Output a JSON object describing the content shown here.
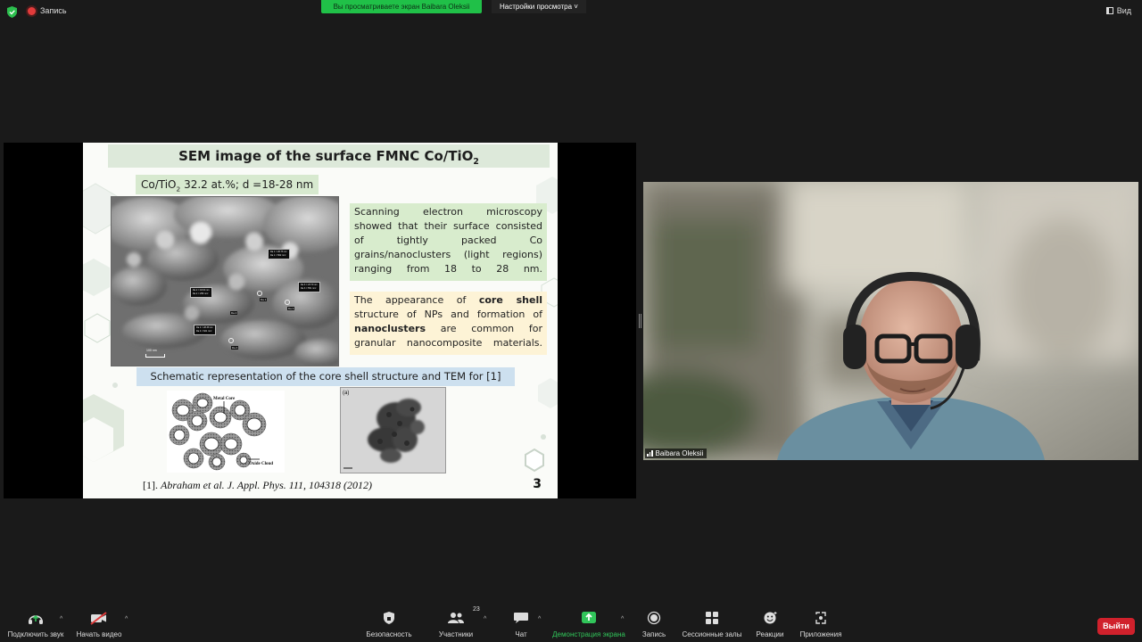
{
  "topbar": {
    "record_label": "Запись",
    "sharing_banner": "Вы просматриваете экран Baibara Oleksii",
    "view_settings": "Настройки просмотра",
    "view_label": "Вид"
  },
  "slide": {
    "title": "SEM image of the surface FMNC Co/TiO",
    "title_sub": "2",
    "subtitle_a": "Co/TiO",
    "subtitle_sub": "2",
    "subtitle_b": " 32.2 at.%; d =18-28 nm",
    "green_text": "Scanning electron microscopy showed that their surface consisted of tightly packed Co grains/nanoclusters (light regions) ranging from 18 to 28 nm.",
    "yellow_a": "The appearance of ",
    "yellow_b": "core shell",
    "yellow_c": " structure of NPs and formation of ",
    "yellow_d": "nanoclusters",
    "yellow_e": " are common for granular nanocomposite materials.",
    "schem_label": "Schematic representation of the core shell structure and TEM for [1]",
    "citation_ref": "[1]. ",
    "citation_text": "Abraham et al. J. Appl. Phys. 111, 104318 (2012)",
    "page_number": "3",
    "diagram_core": "Metal Core",
    "diagram_cloud": "Oxide Cloud",
    "tem_panel": "(a)",
    "sem_scale": "100 nm",
    "sem_tags": [
      {
        "l1": "Da 1 = 26.76 nm",
        "l2": "Da 1 = 562 nm²"
      },
      {
        "l1": "Da 2 = 18.04 nm",
        "l2": "Da 2 = 256 nm²"
      },
      {
        "l1": "Da 3 = 23.70 nm",
        "l2": "Da 3 = 551 nm²"
      },
      {
        "l1": "Da 4 = 28.38 nm",
        "l2": "Da 4 = 621 nm²"
      }
    ],
    "sem_nums": [
      "Da 1",
      "Da 2",
      "Da 3",
      "Da 4"
    ]
  },
  "video": {
    "participant_name": "Baibara Oleksii"
  },
  "toolbar": {
    "audio": "Подключить звук",
    "video": "Начать видео",
    "security": "Безопасность",
    "participants": "Участники",
    "participants_count": "23",
    "chat": "Чат",
    "share": "Демонстрация экрана",
    "record": "Запись",
    "breakout": "Сессионные залы",
    "reactions": "Реакции",
    "apps": "Приложения",
    "leave": "Выйти"
  },
  "colors": {
    "accent_green": "#20c048",
    "leave_red": "#d0212c",
    "slide_title_bg": "#dde9da",
    "green_box": "#d8eccd",
    "yellow_box": "#fdf3d6",
    "blue_box": "#cde0ef"
  }
}
